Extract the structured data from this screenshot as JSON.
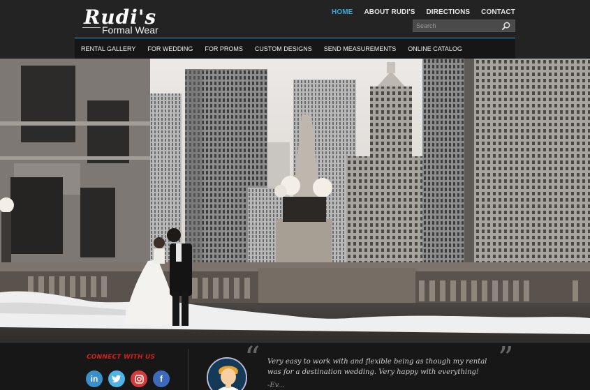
{
  "logo": {
    "script": "Rudi's",
    "sub": "Formal Wear"
  },
  "topnav": [
    {
      "label": "HOME",
      "active": true
    },
    {
      "label": "ABOUT RUDI'S",
      "active": false
    },
    {
      "label": "DIRECTIONS",
      "active": false
    },
    {
      "label": "CONTACT",
      "active": false
    }
  ],
  "search": {
    "placeholder": "Search",
    "icon": "magnifier-icon"
  },
  "mainnav": [
    "RENTAL GALLERY",
    "FOR WEDDING",
    "FOR PROMS",
    "CUSTOM DESIGNS",
    "SEND MEASUREMENTS",
    "ONLINE CATALOG"
  ],
  "hero": {
    "subject": "wedding couple on snowy riverwalk with skyscrapers"
  },
  "footer": {
    "connect_label": "CONNECT WITH US",
    "socials": [
      {
        "name": "linkedin-icon",
        "glyph": "in",
        "color": "#3a8fc9"
      },
      {
        "name": "twitter-icon",
        "glyph": "t",
        "color": "#4eb3e8"
      },
      {
        "name": "instagram-icon",
        "glyph": "◎",
        "color": "#d53b3b"
      },
      {
        "name": "facebook-icon",
        "glyph": "f",
        "color": "#3c6bbd"
      }
    ],
    "quote_open": "“",
    "quote_close": "”",
    "testimonial": "Very easy to work with and flexible being as though my rental was for a destination wedding. Very happy with everything!",
    "author": "-Ev..."
  },
  "colors": {
    "accent": "#39a6d8",
    "connect": "#d0201f",
    "bg": "#1c1c1c"
  }
}
